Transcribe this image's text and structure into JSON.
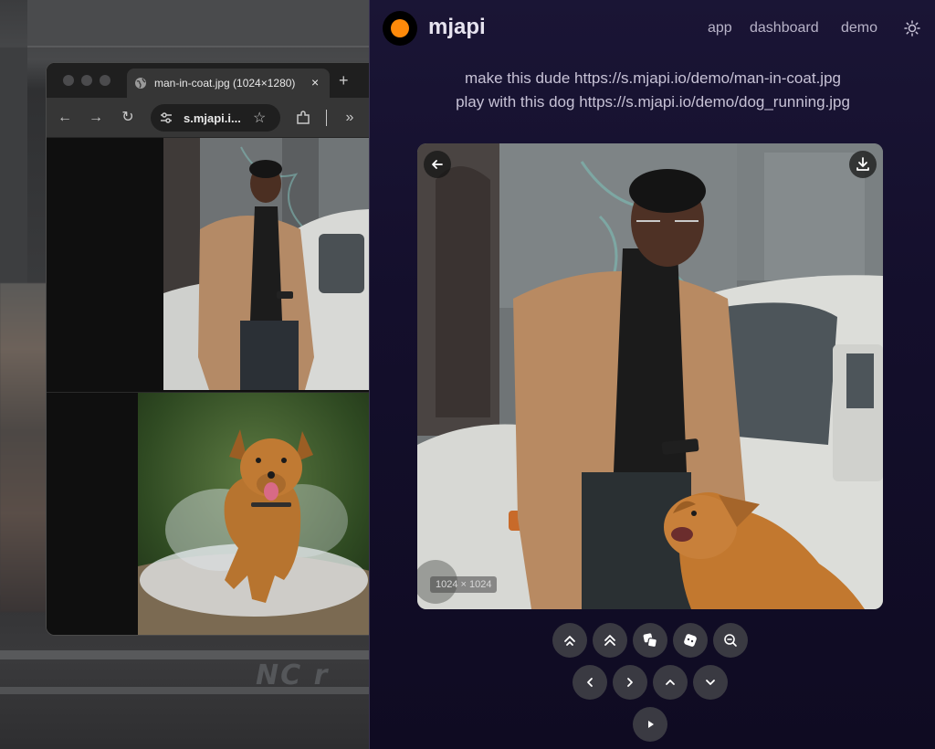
{
  "browser": {
    "tab_title": "man-in-coat.jpg (1024×1280)",
    "tab_close": "×",
    "new_tab": "+",
    "url_short": "s.mjapi.i...",
    "back": "←",
    "forward": "→",
    "reload": "↻",
    "star": "☆",
    "overflow": "»"
  },
  "app": {
    "brand": "mjapi",
    "nav": [
      "app",
      "dashboard",
      "demo"
    ],
    "prompt_lines": [
      "make this dude https://s.mjapi.io/demo/man-in-coat.jpg",
      "play with this dog https://s.mjapi.io/demo/dog_running.jpg"
    ],
    "image_dimensions": "1024 × 1024",
    "controls_row1": [
      "upscale-subtle-icon",
      "upscale-creative-icon",
      "vary-strong-icon",
      "vary-subtle-icon",
      "zoom-out-icon"
    ],
    "controls_row2": [
      "pan-left-icon",
      "pan-right-icon",
      "pan-up-icon",
      "pan-down-icon"
    ],
    "controls_row3": [
      "play-icon"
    ]
  },
  "colors": {
    "accent": "#ff8a0a",
    "app_bg": "#140f2c",
    "control_bg": "#3a3a42"
  },
  "desktop": {
    "graffiti": "NC r"
  }
}
